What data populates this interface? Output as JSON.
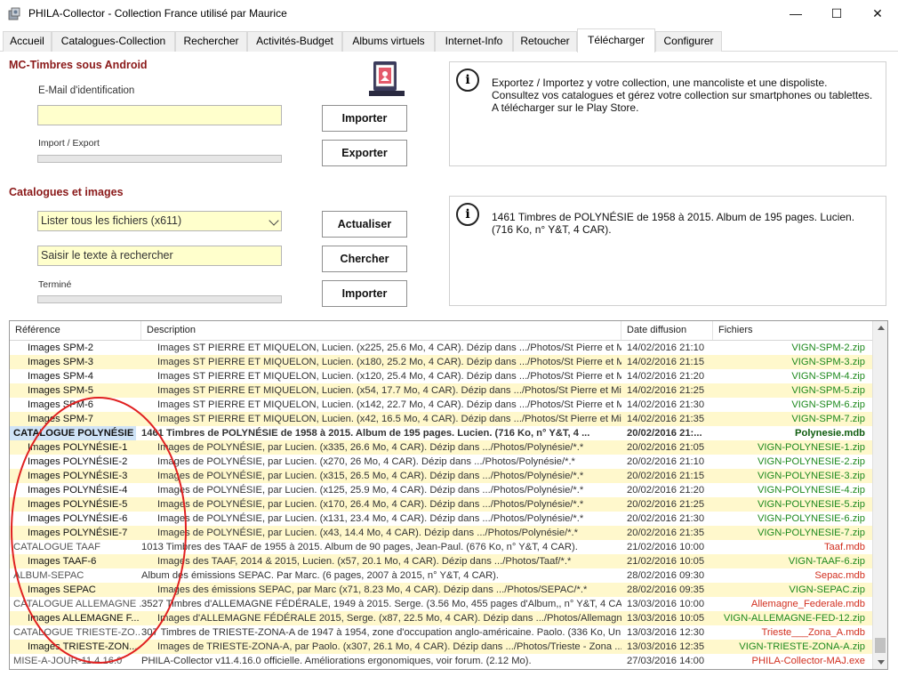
{
  "window": {
    "title": "PHILA-Collector - Collection France utilisé par Maurice",
    "minimize_glyph": "—",
    "maximize_glyph": "☐",
    "close_glyph": "✕"
  },
  "tabs": [
    {
      "label": "Accueil",
      "active": false
    },
    {
      "label": "Catalogues-Collection",
      "active": false
    },
    {
      "label": "Rechercher",
      "active": false
    },
    {
      "label": "Activités-Budget",
      "active": false
    },
    {
      "label": "Albums virtuels",
      "active": false
    },
    {
      "label": "Internet-Info",
      "active": false
    },
    {
      "label": "Retoucher",
      "active": false
    },
    {
      "label": "Télécharger",
      "active": true
    },
    {
      "label": "Configurer",
      "active": false
    }
  ],
  "mc_timbres": {
    "title": "MC-Timbres sous Android",
    "email_label": "E-Mail d'identification",
    "email_value": "",
    "import_export_label": "Import / Export",
    "import_button": "Importer",
    "export_button": "Exporter",
    "progress": 0,
    "info_text": "Exportez / Importez y votre collection, une mancoliste et une dispoliste. Consultez vos catalogues et gérez votre collection sur smartphones ou tablettes. A télécharger sur le Play Store."
  },
  "catalogues": {
    "title": "Catalogues et images",
    "filter_selected": "Lister tous les fichiers (x611)",
    "search_placeholder": "Saisir le texte à rechercher",
    "status_label": "Terminé",
    "progress": 0,
    "refresh_button": "Actualiser",
    "search_button": "Chercher",
    "import_button": "Importer",
    "info_text": "1461 Timbres de POLYNÉSIE de 1958 à 2015. Album de 195 pages. Lucien. (716 Ko, n° Y&T, 4 CAR)."
  },
  "table": {
    "headers": {
      "reference": "Référence",
      "description": "Description",
      "date": "Date diffusion",
      "files": "Fichiers"
    },
    "rows": [
      {
        "ref": "Images SPM-2",
        "desc": "Images ST PIERRE ET MIQUELON, Lucien. (x225, 25.6 Mo, 4 CAR). Dézip dans .../Photos/St Pierre et Mi...",
        "date": "14/02/2016 21:10",
        "file": "VIGN-SPM-2.zip",
        "style": "child",
        "color": "green"
      },
      {
        "ref": "Images SPM-3",
        "desc": "Images ST PIERRE ET MIQUELON, Lucien. (x180, 25.2 Mo, 4 CAR). Dézip dans .../Photos/St Pierre et Mi...",
        "date": "14/02/2016 21:15",
        "file": "VIGN-SPM-3.zip",
        "style": "child",
        "color": "green"
      },
      {
        "ref": "Images SPM-4",
        "desc": "Images ST PIERRE ET MIQUELON, Lucien. (x120, 25.4 Mo, 4 CAR). Dézip dans .../Photos/St Pierre et Mi...",
        "date": "14/02/2016 21:20",
        "file": "VIGN-SPM-4.zip",
        "style": "child",
        "color": "green"
      },
      {
        "ref": "Images SPM-5",
        "desc": "Images ST PIERRE ET MIQUELON, Lucien. (x54, 17.7 Mo, 4 CAR). Dézip dans .../Photos/St Pierre et Miq...",
        "date": "14/02/2016 21:25",
        "file": "VIGN-SPM-5.zip",
        "style": "child",
        "color": "green"
      },
      {
        "ref": "Images SPM-6",
        "desc": "Images ST PIERRE ET MIQUELON, Lucien. (x142, 22.7 Mo, 4 CAR). Dézip dans .../Photos/St Pierre et Mi...",
        "date": "14/02/2016 21:30",
        "file": "VIGN-SPM-6.zip",
        "style": "child",
        "color": "green"
      },
      {
        "ref": "Images SPM-7",
        "desc": "Images ST PIERRE ET MIQUELON, Lucien. (x42, 16.5 Mo, 4 CAR). Dézip dans .../Photos/St Pierre et Miq...",
        "date": "14/02/2016 21:35",
        "file": "VIGN-SPM-7.zip",
        "style": "child",
        "color": "green"
      },
      {
        "ref": "CATALOGUE POLYNÉSIE",
        "desc": "1461 Timbres de POLYNÉSIE de 1958 à 2015. Album de 195 pages. Lucien. (716 Ko, n° Y&T, 4 ...",
        "date": "20/02/2016 21:...",
        "file": "Polynesie.mdb",
        "style": "bold",
        "color": "dgreen"
      },
      {
        "ref": "Images POLYNÉSIE-1",
        "desc": "Images de POLYNÉSIE, par Lucien. (x335, 26.6 Mo, 4 CAR). Dézip dans .../Photos/Polynésie/*.*",
        "date": "20/02/2016 21:05",
        "file": "VIGN-POLYNESIE-1.zip",
        "style": "child",
        "color": "green"
      },
      {
        "ref": "Images POLYNÉSIE-2",
        "desc": "Images de POLYNÉSIE, par Lucien. (x270, 26 Mo, 4 CAR). Dézip dans .../Photos/Polynésie/*.*",
        "date": "20/02/2016 21:10",
        "file": "VIGN-POLYNESIE-2.zip",
        "style": "child",
        "color": "green"
      },
      {
        "ref": "Images POLYNÉSIE-3",
        "desc": "Images de POLYNÉSIE, par Lucien. (x315, 26.5 Mo, 4 CAR). Dézip dans .../Photos/Polynésie/*.*",
        "date": "20/02/2016 21:15",
        "file": "VIGN-POLYNESIE-3.zip",
        "style": "child",
        "color": "green"
      },
      {
        "ref": "Images POLYNÉSIE-4",
        "desc": "Images de POLYNÉSIE, par Lucien. (x125, 25.9 Mo, 4 CAR). Dézip dans .../Photos/Polynésie/*.*",
        "date": "20/02/2016 21:20",
        "file": "VIGN-POLYNESIE-4.zip",
        "style": "child",
        "color": "green"
      },
      {
        "ref": "Images POLYNÉSIE-5",
        "desc": "Images de POLYNÉSIE, par Lucien. (x170, 26.4 Mo, 4 CAR). Dézip dans .../Photos/Polynésie/*.*",
        "date": "20/02/2016 21:25",
        "file": "VIGN-POLYNESIE-5.zip",
        "style": "child",
        "color": "green"
      },
      {
        "ref": "Images POLYNÉSIE-6",
        "desc": "Images de POLYNÉSIE, par Lucien. (x131, 23.4 Mo, 4 CAR). Dézip dans .../Photos/Polynésie/*.*",
        "date": "20/02/2016 21:30",
        "file": "VIGN-POLYNESIE-6.zip",
        "style": "child",
        "color": "green"
      },
      {
        "ref": "Images POLYNÉSIE-7",
        "desc": "Images de POLYNÉSIE, par Lucien. (x43, 14.4 Mo, 4 CAR). Dézip dans .../Photos/Polynésie/*.*",
        "date": "20/02/2016 21:35",
        "file": "VIGN-POLYNESIE-7.zip",
        "style": "child",
        "color": "green"
      },
      {
        "ref": "CATALOGUE TAAF",
        "desc": "1013 Timbres des TAAF de 1955 à 2015. Album de 90 pages, Jean-Paul. (676 Ko, n° Y&T, 4 CAR).",
        "date": "21/02/2016 10:00",
        "file": "Taaf.mdb",
        "style": "top",
        "color": "red"
      },
      {
        "ref": "Images TAAF-6",
        "desc": "Images des TAAF, 2014 & 2015, Lucien. (x57, 20.1 Mo, 4 CAR). Dézip dans .../Photos/Taaf/*.*",
        "date": "21/02/2016 10:05",
        "file": "VIGN-TAAF-6.zip",
        "style": "child",
        "color": "green"
      },
      {
        "ref": "ALBUM-SEPAC",
        "desc": "Album des émissions SEPAC. Par Marc. (6 pages, 2007 à 2015, n° Y&T, 4 CAR).",
        "date": "28/02/2016 09:30",
        "file": "Sepac.mdb",
        "style": "top",
        "color": "red"
      },
      {
        "ref": "Images SEPAC",
        "desc": "Images des émissions SEPAC, par Marc (x71, 8.23 Mo, 4 CAR). Dézip dans .../Photos/SEPAC/*.*",
        "date": "28/02/2016 09:35",
        "file": "VIGN-SEPAC.zip",
        "style": "child",
        "color": "green"
      },
      {
        "ref": "CATALOGUE ALLEMAGNE ...",
        "desc": "3527 Timbres d'ALLEMAGNE FÉDÉRALE, 1949 à 2015. Serge. (3.56 Mo, 455 pages d'Album,, n° Y&T, 4 CAR).",
        "date": "13/03/2016 10:00",
        "file": "Allemagne_Federale.mdb",
        "style": "top",
        "color": "red"
      },
      {
        "ref": "Images ALLEMAGNE F...",
        "desc": "Images d'ALLEMAGNE FÉDÉRALE 2015, Serge. (x87, 22.5 Mo, 4 CAR). Dézip dans .../Photos/Allemagne ...",
        "date": "13/03/2016 10:05",
        "file": "VIGN-ALLEMAGNE-FED-12.zip",
        "style": "child",
        "color": "green"
      },
      {
        "ref": "CATALOGUE TRIESTE-ZO...",
        "desc": "307 Timbres de TRIESTE-ZONA-A de 1947 à 1954, zone d'occupation anglo-américaine. Paolo. (336 Ko, Unifi...",
        "date": "13/03/2016 12:30",
        "file": "Trieste___Zona_A.mdb",
        "style": "top",
        "color": "red"
      },
      {
        "ref": "Images TRIESTE-ZON...",
        "desc": "Images de TRIESTE-ZONA-A, par Paolo. (x307, 26.1 Mo, 4 CAR). Dézip dans .../Photos/Trieste - Zona ...",
        "date": "13/03/2016 12:35",
        "file": "VIGN-TRIESTE-ZONA-A.zip",
        "style": "child",
        "color": "green"
      },
      {
        "ref": "MISE-A-JOUR-11.4.16.0",
        "desc": "PHILA-Collector v11.4.16.0 officielle. Améliorations ergonomiques, voir forum. (2.12 Mo).",
        "date": "27/03/2016 14:00",
        "file": "PHILA-Collector-MAJ.exe",
        "style": "top",
        "color": "red"
      }
    ]
  },
  "colors": {
    "accent_title": "#8b1a1a",
    "input_bg": "#ffffcc",
    "row_highlight": "#fff8cc",
    "file_green": "#1f8a1f",
    "file_red": "#d22f1f",
    "annotation": "#e02020"
  },
  "icons": {
    "app": "stamp-app-icon",
    "android": "android-stamp-icon",
    "info": "info-icon"
  }
}
